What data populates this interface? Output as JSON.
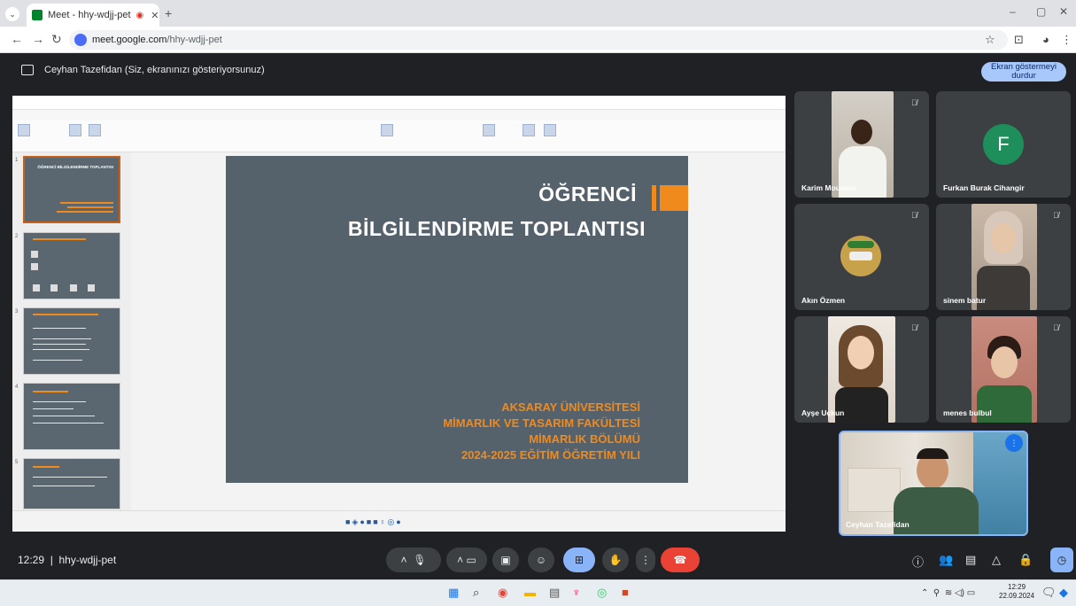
{
  "browser": {
    "tab_title": "Meet - hhy-wdjj-pet",
    "url_domain": "meet.google.com",
    "url_path": "/hhy-wdjj-pet"
  },
  "meet": {
    "presenting_text": "Ceyhan Tazefidan (Siz, ekranınızı gösteriyorsunuz)",
    "stop_button": "Ekran göstermeyi durdur",
    "time": "12:29",
    "meeting_code": "hhy-wdjj-pet"
  },
  "slide": {
    "title_line1": "ÖĞRENCİ",
    "title_line2": "BİLGİLENDİRME TOPLANTISI",
    "org_lines": [
      "AKSARAY ÜNİVERSİTESİ",
      "MİMARLIK VE TASARIM FAKÜLTESİ",
      "MİMARLIK BÖLÜMÜ",
      "2024-2025 EĞİTİM ÖĞRETİM YILI"
    ],
    "thumb1_title": "ÖĞRENCİ BİLGİLENDİRME TOPLANTISI"
  },
  "participants": [
    {
      "name": "Karim Moumini",
      "avatar_letter": ""
    },
    {
      "name": "Furkan Burak Cihangir",
      "avatar_letter": "F"
    },
    {
      "name": "Akın Özmen",
      "avatar_letter": ""
    },
    {
      "name": "sinem batur",
      "avatar_letter": ""
    },
    {
      "name": "Ayşe Uçkun",
      "avatar_letter": ""
    },
    {
      "name": "menes bulbul",
      "avatar_letter": ""
    },
    {
      "name": "Ceyhan Tazefidan",
      "avatar_letter": ""
    }
  ],
  "taskbar": {
    "time": "12:29",
    "date": "22.09.2024"
  },
  "colors": {
    "meet_bg": "#202124",
    "tile_bg": "#3c4043",
    "slide_bg": "#56626b",
    "slide_accent": "#f08a1c",
    "end_call": "#ea4335",
    "present_active": "#8ab4f8"
  }
}
